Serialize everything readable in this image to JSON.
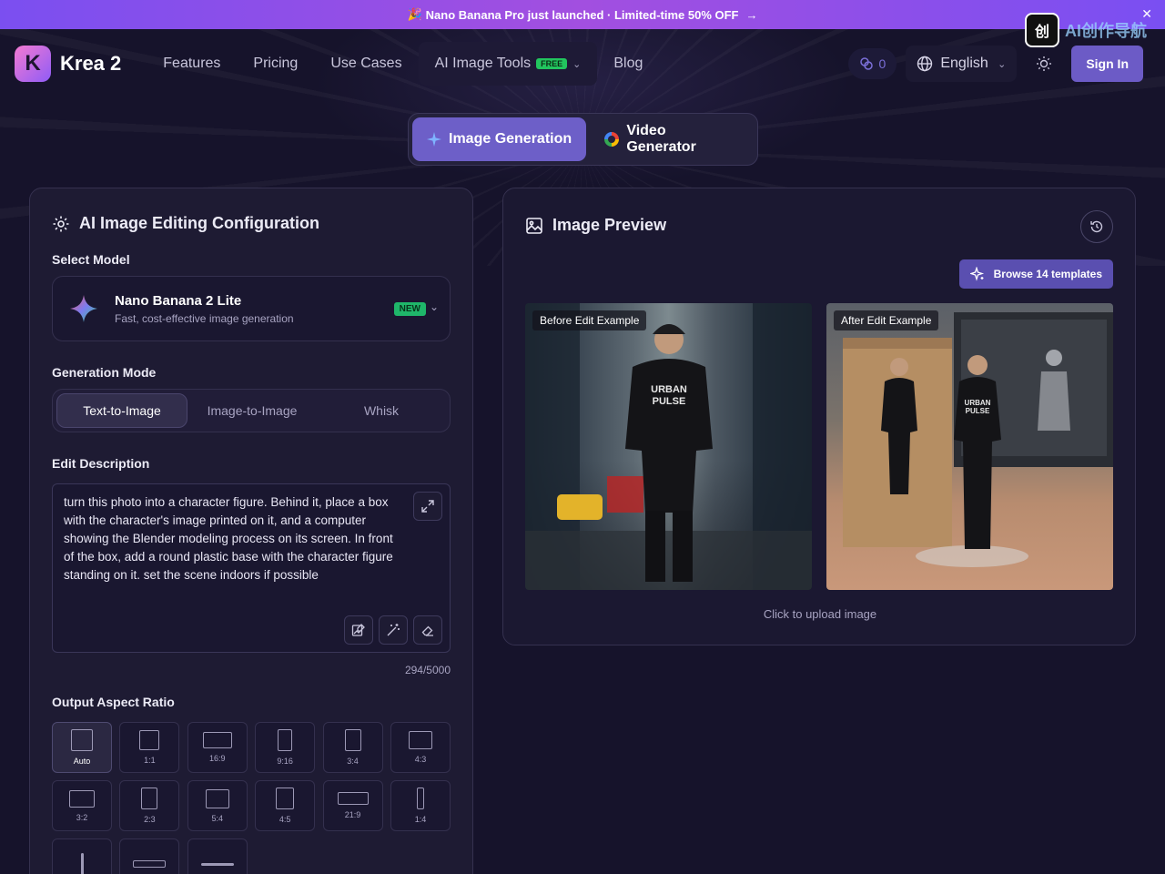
{
  "promo": {
    "emoji": "🎉",
    "text": "Nano Banana Pro just launched · Limited-time 50% OFF",
    "arrow": "→",
    "close": "✕"
  },
  "watermark": {
    "badge": "创",
    "text": "AI创作导航"
  },
  "header": {
    "logo_letter": "K",
    "logo_text": "Krea 2",
    "nav": [
      "Features",
      "Pricing",
      "Use Cases",
      "AI Image Tools",
      "Blog"
    ],
    "tools_badge": "FREE",
    "credits": "0",
    "language": "English",
    "sign_in": "Sign In"
  },
  "mode_tabs": [
    {
      "label": "Image Generation",
      "active": true
    },
    {
      "label": "Video Generator",
      "active": false
    }
  ],
  "config": {
    "title": "AI Image Editing Configuration",
    "select_model_label": "Select Model",
    "model": {
      "name": "Nano Banana 2 Lite",
      "desc": "Fast, cost-effective image generation",
      "badge": "NEW"
    },
    "generation_mode_label": "Generation Mode",
    "generation_modes": [
      "Text-to-Image",
      "Image-to-Image",
      "Whisk"
    ],
    "edit_description_label": "Edit Description",
    "description": "turn this photo into a character figure. Behind it, place a box with the character's image printed on it, and a computer showing the Blender modeling process on its screen. In front of the box, add a round plastic base with the character figure standing on it. set the scene indoors if possible",
    "counter": "294/5000",
    "aspect_ratio_label": "Output Aspect Ratio",
    "ratios": [
      "Auto",
      "1:1",
      "16:9",
      "9:16",
      "3:4",
      "4:3",
      "3:2",
      "2:3",
      "5:4",
      "4:5",
      "21:9",
      "1:4",
      "",
      "",
      ""
    ]
  },
  "preview": {
    "title": "Image Preview",
    "browse": "Browse 14 templates",
    "before_label": "Before Edit Example",
    "after_label": "After Edit Example",
    "upload_hint": "Click to upload image"
  },
  "colors": {
    "accent": "#6d5fc8",
    "promo_start": "#7b4ff0",
    "badge_green": "#22c55e"
  }
}
